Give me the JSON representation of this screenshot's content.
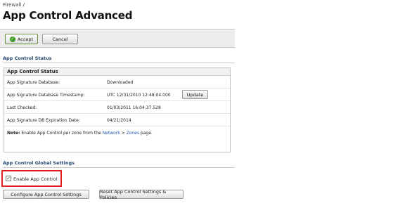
{
  "breadcrumb": "Firewall /",
  "page_title": "App Control Advanced",
  "toolbar": {
    "accept_label": "Accept",
    "cancel_label": "Cancel"
  },
  "status_section": {
    "header": "App Control Status",
    "panel_title": "App Control Status",
    "rows": [
      {
        "label": "App Signature Database:",
        "value": "Downloaded"
      },
      {
        "label": "App Signature Database Timestamp:",
        "value": "UTC 12/31/2010 12:48:04.000",
        "button": "Update"
      },
      {
        "label": "Last Checked:",
        "value": "01/03/2011 16:04:37.528"
      },
      {
        "label": "App Signature DB Expiration Date:",
        "value": "04/21/2014"
      }
    ],
    "note": {
      "prefix": "Note:",
      "text1": " Enable App Control per zone from the ",
      "link1": "Network",
      "sep": " > ",
      "link2": "Zones",
      "text2": " page."
    }
  },
  "global_section": {
    "header": "App Control Global Settings",
    "enable_label": "Enable App Control",
    "enable_checked": true,
    "configure_button": "Configure App Control Settings",
    "reset_button": "Reset App Control Settings & Policies"
  },
  "colors": {
    "highlight_border": "#e02020",
    "section_header": "#23466e",
    "link": "#1a54a8"
  }
}
